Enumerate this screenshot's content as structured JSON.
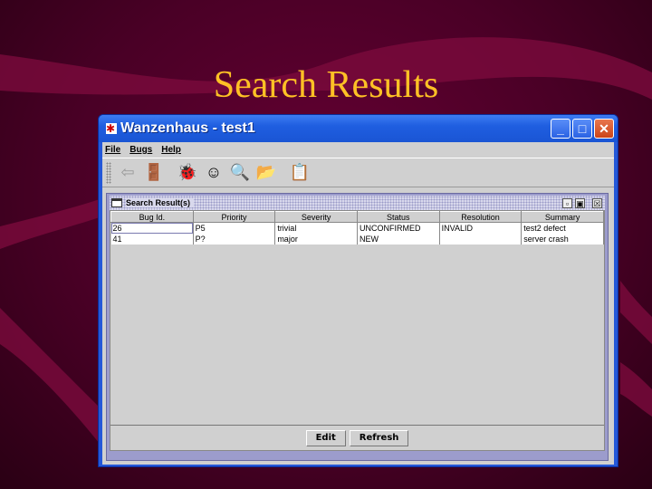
{
  "slide": {
    "title": "Search Results"
  },
  "window": {
    "title": "Wanzenhaus - test1",
    "controls": {
      "minimize": "_",
      "maximize": "□",
      "close": "✕"
    }
  },
  "menu": {
    "items": [
      "File",
      "Bugs",
      "Help"
    ]
  },
  "toolbar": {
    "buttons": [
      {
        "name": "logout",
        "icon": "⇦",
        "enabled": false
      },
      {
        "name": "door",
        "icon": "🚪",
        "enabled": true
      },
      {
        "name": "bug",
        "icon": "🐞",
        "enabled": true
      },
      {
        "name": "face",
        "icon": "☺",
        "enabled": true
      },
      {
        "name": "search",
        "icon": "🔍",
        "enabled": true
      },
      {
        "name": "folder",
        "icon": "📂",
        "enabled": true
      },
      {
        "name": "user-guide",
        "icon": "📋",
        "enabled": true
      }
    ]
  },
  "internal_frame": {
    "title": "Search Result(s)",
    "controls": {
      "iconify": "▫",
      "maximize": "▣",
      "close": "☒"
    }
  },
  "table": {
    "columns": [
      "Bug Id.",
      "Priority",
      "Severity",
      "Status",
      "Resolution",
      "Summary"
    ],
    "rows": [
      [
        "26",
        "P5",
        "trivial",
        "UNCONFIRMED",
        "INVALID",
        "test2 defect"
      ],
      [
        "41",
        "P?",
        "major",
        "NEW",
        "",
        "server crash"
      ]
    ]
  },
  "buttons": {
    "edit": "Edit",
    "refresh": "Refresh"
  }
}
